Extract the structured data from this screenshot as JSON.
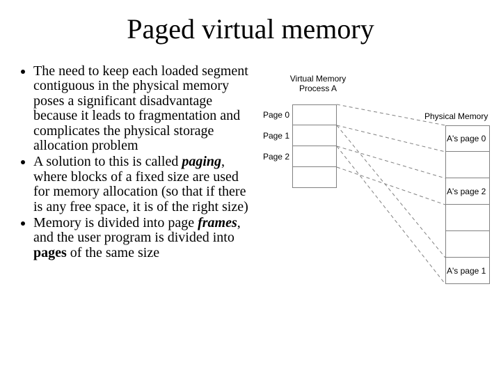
{
  "title": "Paged virtual memory",
  "bullets": [
    {
      "pre": "The need to keep each loaded segment contiguous in the physical memory poses a significant disadvantage because it leads to fragmentation and complicates the physical storage allocation problem",
      "b1": "",
      "mid1": "",
      "b2": "",
      "mid2": "",
      "b3": "",
      "tail": ""
    },
    {
      "pre": "A solution to this is called ",
      "b1": "paging",
      "mid1": ", where blocks of a fixed size are used for memory allocation (so that if there is any free space, it is of the right size)",
      "b2": "",
      "mid2": "",
      "b3": "",
      "tail": ""
    },
    {
      "pre": "Memory is divided into page ",
      "b1": "frames",
      "mid1": ", and the user program is divided into ",
      "b2": "pages",
      "mid2": " of the same size",
      "b3": "",
      "tail": ""
    }
  ],
  "figure": {
    "vm_title_l1": "Virtual Memory",
    "vm_title_l2": "Process A",
    "pm_title": "Physical Memory",
    "vm_labels": [
      "Page 0",
      "Page 1",
      "Page 2"
    ],
    "pm_labels": [
      "A's page 0",
      "",
      "A's page 2",
      "",
      "",
      "A's page 1"
    ]
  }
}
